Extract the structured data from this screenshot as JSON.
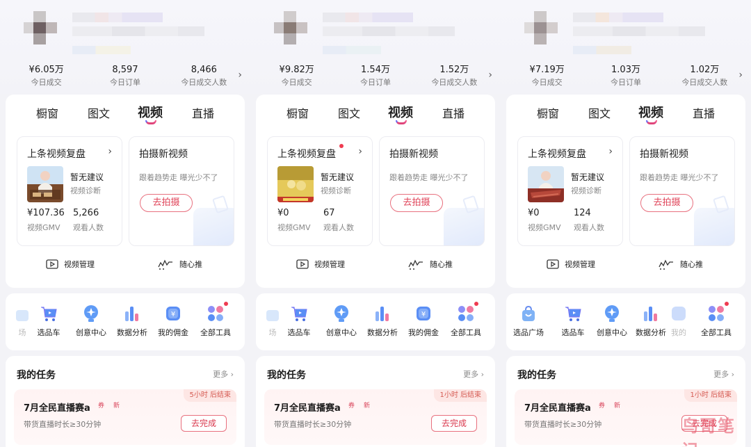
{
  "panels": [
    {
      "stats": [
        {
          "value": "¥6.05万",
          "label": "今日成交"
        },
        {
          "value": "8,597",
          "label": "今日订单"
        },
        {
          "value": "8,466",
          "label": "今日成交人数"
        }
      ],
      "tabs": [
        "橱窗",
        "图文",
        "视频",
        "直播"
      ],
      "active_tab": "视频",
      "last_video": {
        "title": "上条视频复盘",
        "suggestion": "暂无建议",
        "suggestion_sub": "视频诊断",
        "gmv_value": "¥107.36",
        "gmv_label": "视频GMV",
        "viewers_value": "5,266",
        "viewers_label": "观看人数",
        "has_dot": false
      },
      "new_video": {
        "title": "拍摄新视频",
        "subtitle": "跟着趋势走 曝光少不了",
        "button": "去拍摄"
      },
      "links": {
        "manage": "视频管理",
        "push": "随心推"
      },
      "tools": [
        "场",
        "选品车",
        "创意中心",
        "数据分析",
        "我的佣金",
        "全部工具"
      ],
      "tasks": {
        "title": "我的任务",
        "more": "更多",
        "item": {
          "title": "7月全民直播赛a",
          "tag1": "券",
          "tag2": "新",
          "time": "5小时  后结束",
          "desc": "带货直播时长≥30分钟",
          "button": "去完成"
        }
      }
    },
    {
      "stats": [
        {
          "value": "¥9.82万",
          "label": "今日成交"
        },
        {
          "value": "1.54万",
          "label": "今日订单"
        },
        {
          "value": "1.52万",
          "label": "今日成交人数"
        }
      ],
      "tabs": [
        "橱窗",
        "图文",
        "视频",
        "直播"
      ],
      "active_tab": "视频",
      "last_video": {
        "title": "上条视频复盘",
        "suggestion": "暂无建议",
        "suggestion_sub": "视频诊断",
        "gmv_value": "¥0",
        "gmv_label": "视频GMV",
        "viewers_value": "67",
        "viewers_label": "观看人数",
        "has_dot": true
      },
      "new_video": {
        "title": "拍摄新视频",
        "subtitle": "跟着趋势走 曝光少不了",
        "button": "去拍摄"
      },
      "links": {
        "manage": "视频管理",
        "push": "随心推"
      },
      "tools": [
        "场",
        "选品车",
        "创意中心",
        "数据分析",
        "我的佣金",
        "全部工具"
      ],
      "tasks": {
        "title": "我的任务",
        "more": "更多",
        "item": {
          "title": "7月全民直播赛a",
          "tag1": "券",
          "tag2": "新",
          "time": "1小时  后结束",
          "desc": "带货直播时长≥30分钟",
          "button": "去完成"
        }
      }
    },
    {
      "stats": [
        {
          "value": "¥7.19万",
          "label": "今日成交"
        },
        {
          "value": "1.03万",
          "label": "今日订单"
        },
        {
          "value": "1.02万",
          "label": "今日成交人数"
        }
      ],
      "tabs": [
        "橱窗",
        "图文",
        "视频",
        "直播"
      ],
      "active_tab": "视频",
      "last_video": {
        "title": "上条视频复盘",
        "suggestion": "暂无建议",
        "suggestion_sub": "视频诊断",
        "gmv_value": "¥0",
        "gmv_label": "视频GMV",
        "viewers_value": "124",
        "viewers_label": "观看人数",
        "has_dot": false
      },
      "new_video": {
        "title": "拍摄新视频",
        "subtitle": "跟着趋势走 曝光少不了",
        "button": "去拍摄"
      },
      "links": {
        "manage": "视频管理",
        "push": "随心推"
      },
      "tools": [
        "选品广场",
        "选品车",
        "创意中心",
        "数据分析",
        "我的",
        "全部工具"
      ],
      "tasks": {
        "title": "我的任务",
        "more": "更多",
        "item": {
          "title": "7月全民直播赛a",
          "tag1": "券",
          "tag2": "新",
          "time": "1小时  后结束",
          "desc": "带货直播时长≥30分钟",
          "button": "去完成"
        }
      }
    }
  ],
  "watermark": "鸟哥笔记",
  "colors": {
    "accent": "#e0455a",
    "underline_left": "#6a6cf2",
    "underline_right": "#f0578b",
    "task_bg": "#fff3f3"
  }
}
